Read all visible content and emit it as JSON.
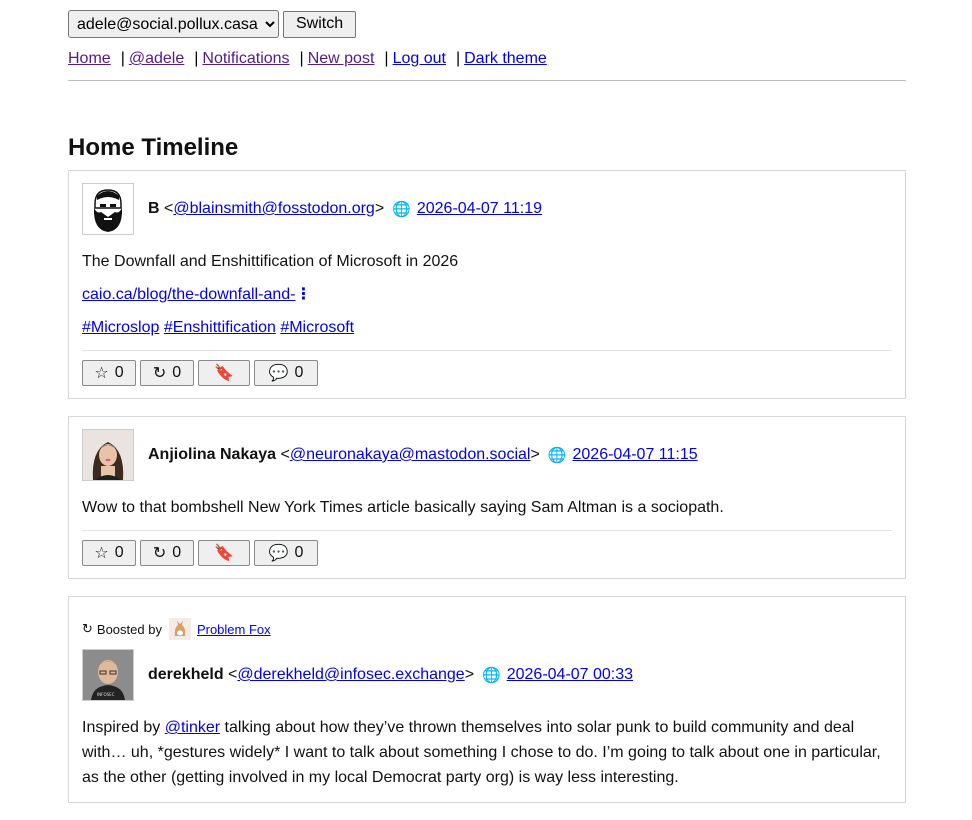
{
  "account": {
    "selected": "adele@social.pollux.casa",
    "switch_label": "Switch"
  },
  "nav": {
    "home": "Home",
    "profile": "@adele",
    "notifications": "Notifications",
    "new_post": "New post",
    "logout": "Log out",
    "dark_theme": "Dark theme",
    "separator": "|"
  },
  "page_title": "Home Timeline",
  "posts": [
    {
      "author": "B",
      "handle": "@blainsmith@fosstodon.org",
      "timestamp": "2026-04-07 11:19",
      "text": "The Downfall and Enshittification of Microsoft in 2026",
      "link": "caio.ca/blog/the-downfall-and-",
      "tags": [
        "#Microslop",
        "#Enshittification",
        "#Microsoft"
      ],
      "stars": "0",
      "boosts": "0",
      "replies": "0"
    },
    {
      "author": "Anjiolina Nakaya",
      "handle": "@neuronakaya@mastodon.social",
      "timestamp": "2026-04-07 11:15",
      "text": "Wow to that bombshell New York Times article basically saying Sam Altman is a sociopath.",
      "stars": "0",
      "boosts": "0",
      "replies": "0"
    },
    {
      "boosted_by_label": "Boosted by",
      "boosted_by": "Problem Fox",
      "author": "derekheld",
      "handle": "@derekheld@infosec.exchange",
      "timestamp": "2026-04-07 00:33",
      "text_before": "Inspired by ",
      "mention": "@tinker",
      "text_after": " talking about how they’ve thrown themselves into solar punk to build community and deal with… uh, *gestures widely* I want to talk about something I chose to do. I’m going to talk about one in particular, as the other (getting involved in my local Democrat party org) is way less interesting."
    }
  ],
  "glyphs": {
    "star": "☆",
    "boost": "↻",
    "bookmark": "🔖",
    "reply": "💬",
    "globe": "🌐",
    "lt": "<",
    "gt": ">"
  },
  "icons": [
    "globe-icon",
    "star-icon",
    "boost-icon",
    "bookmark-icon",
    "reply-icon"
  ]
}
